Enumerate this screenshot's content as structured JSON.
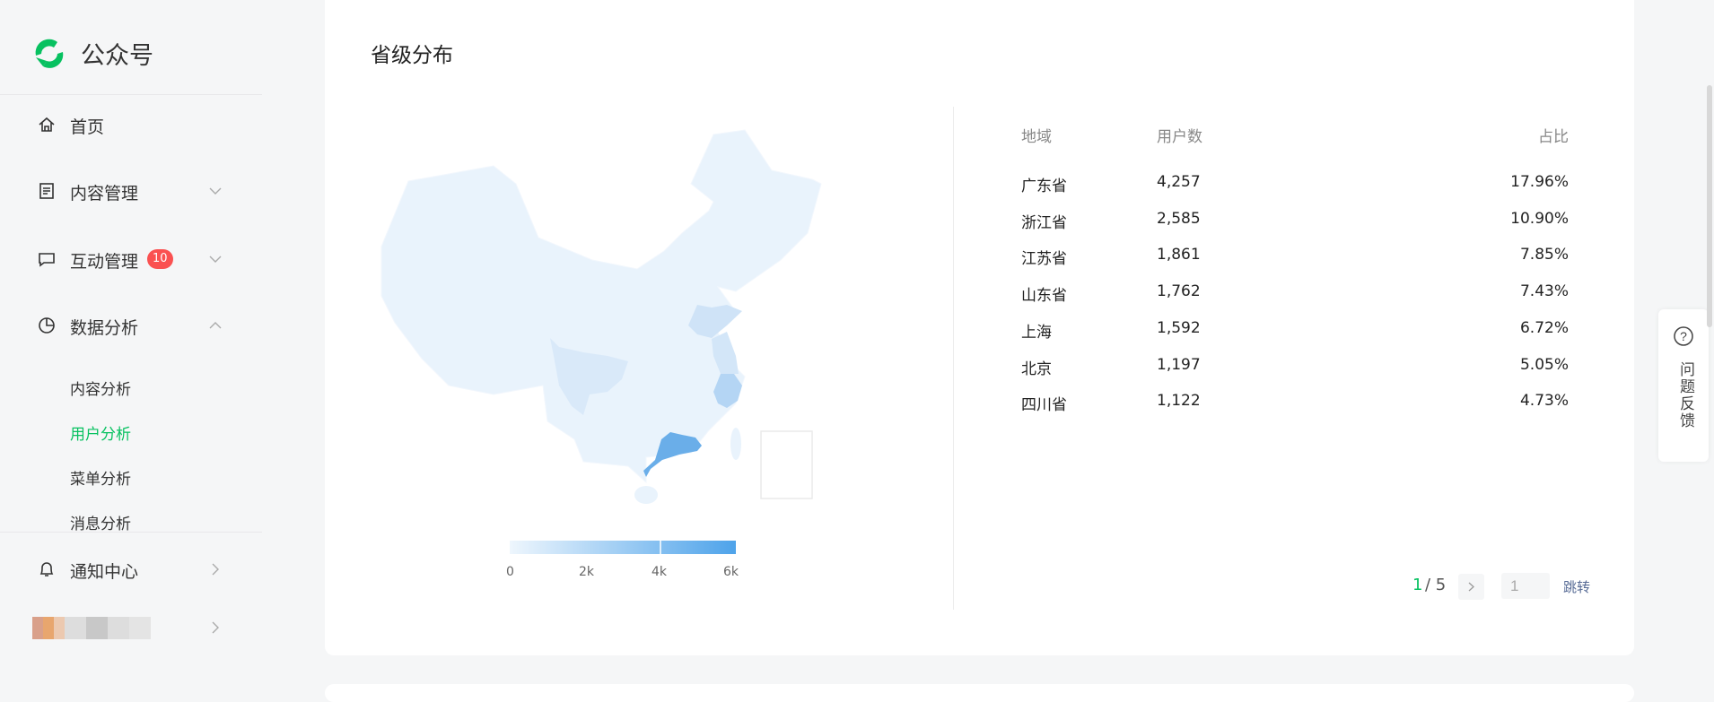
{
  "app": {
    "title": "公众号"
  },
  "sidebar": {
    "items": [
      {
        "label": "首页",
        "icon": "home-icon"
      },
      {
        "label": "内容管理",
        "icon": "document-icon"
      },
      {
        "label": "互动管理",
        "icon": "message-icon",
        "badge": "10"
      },
      {
        "label": "数据分析",
        "icon": "pie-chart-icon"
      }
    ],
    "sub_items": [
      {
        "label": "内容分析"
      },
      {
        "label": "用户分析",
        "active": true
      },
      {
        "label": "菜单分析"
      },
      {
        "label": "消息分析"
      }
    ],
    "notification": {
      "label": "通知中心"
    }
  },
  "card": {
    "title": "省级分布"
  },
  "table": {
    "headers": [
      "地域",
      "用户数",
      "占比"
    ],
    "rows": [
      {
        "region": "广东省",
        "users": "4,257",
        "ratio": "17.96%"
      },
      {
        "region": "浙江省",
        "users": "2,585",
        "ratio": "10.90%"
      },
      {
        "region": "江苏省",
        "users": "1,861",
        "ratio": "7.85%"
      },
      {
        "region": "山东省",
        "users": "1,762",
        "ratio": "7.43%"
      },
      {
        "region": "上海",
        "users": "1,592",
        "ratio": "6.72%"
      },
      {
        "region": "北京",
        "users": "1,197",
        "ratio": "5.05%"
      },
      {
        "region": "四川省",
        "users": "1,122",
        "ratio": "4.73%"
      }
    ]
  },
  "pagination": {
    "current": "1",
    "total": "/ 5",
    "jump_value": "1",
    "jump_label": "跳转"
  },
  "chart_data": {
    "type": "choropleth-map",
    "title": "省级分布",
    "legend": {
      "min": 0,
      "max": 6000,
      "ticks": [
        "0",
        "2k",
        "4k",
        "6k"
      ],
      "colors": [
        "#eef6fd",
        "#4ea3ea"
      ]
    },
    "regions": [
      {
        "name": "广东省",
        "value": 4257
      },
      {
        "name": "浙江省",
        "value": 2585
      },
      {
        "name": "江苏省",
        "value": 1861
      },
      {
        "name": "山东省",
        "value": 1762
      },
      {
        "name": "上海",
        "value": 1592
      },
      {
        "name": "北京",
        "value": 1197
      },
      {
        "name": "四川省",
        "value": 1122
      }
    ]
  },
  "feedback": {
    "label": "问题反馈"
  },
  "colors": {
    "accent": "#07c160",
    "badge": "#fa5151",
    "map_high": "#4ea3ea"
  }
}
